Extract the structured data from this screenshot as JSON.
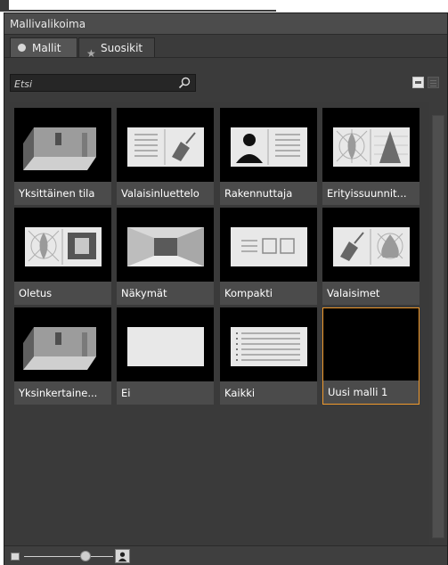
{
  "window": {
    "title": "Mallivalikoima"
  },
  "tabs": [
    {
      "label": "Mallit",
      "icon": "dot-icon",
      "active": true
    },
    {
      "label": "Suosikit",
      "icon": "star-icon",
      "active": false
    }
  ],
  "search": {
    "placeholder": "Etsi",
    "value": ""
  },
  "colors": {
    "panel": "#3b3b3b",
    "tile_label": "#4b4b4b",
    "selection": "#f09a2c"
  },
  "templates": [
    {
      "label": "Yksittäinen tila",
      "thumb": "room-icon"
    },
    {
      "label": "Valaisinluettelo",
      "thumb": "luminaire-list-icon"
    },
    {
      "label": "Rakennuttaja",
      "thumb": "person-list-icon"
    },
    {
      "label": "Erityissuunnit...",
      "thumb": "distribution-curves-icon"
    },
    {
      "label": "Oletus",
      "thumb": "curve-room-icon"
    },
    {
      "label": "Näkymät",
      "thumb": "perspective-room-icon"
    },
    {
      "label": "Kompakti",
      "thumb": "compact-layout-icon"
    },
    {
      "label": "Valaisimet",
      "thumb": "luminaire-curve-icon"
    },
    {
      "label": "Yksinkertaine...",
      "thumb": "room-icon"
    },
    {
      "label": "Ei",
      "thumb": "blank-page-icon"
    },
    {
      "label": "Kaikki",
      "thumb": "list-page-icon"
    },
    {
      "label": "Uusi malli 1",
      "thumb": "empty-icon",
      "selected": true
    }
  ]
}
